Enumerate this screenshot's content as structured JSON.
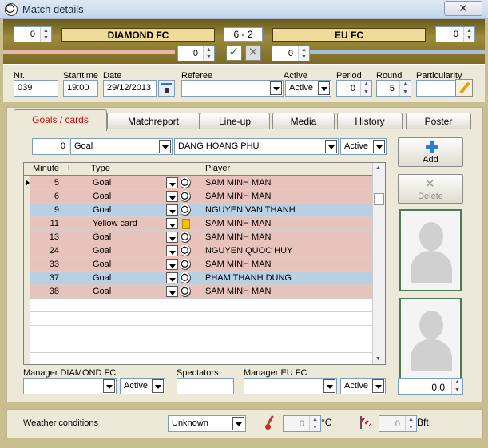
{
  "window": {
    "title": "Match details",
    "close_glyph": "✕"
  },
  "score": {
    "home_team": "DIAMOND FC",
    "away_team": "EU FC",
    "result": "6 - 2",
    "home_left_value": "0",
    "away_right_value": "0",
    "home_mid_value": "0",
    "away_mid_value": "0"
  },
  "info": {
    "nr_label": "Nr.",
    "nr": "039",
    "starttime_label": "Starttime",
    "starttime": "19:00",
    "date_label": "Date",
    "date": "29/12/2013",
    "referee_label": "Referee",
    "referee": "",
    "active_label": "Active",
    "active": "Active",
    "period_label": "Period",
    "period": "0",
    "round_label": "Round",
    "round": "5",
    "particularity_label": "Particularity",
    "particularity": ""
  },
  "tabs": [
    {
      "label": "Goals / cards",
      "active": true
    },
    {
      "label": "Matchreport"
    },
    {
      "label": "Line-up"
    },
    {
      "label": "Media"
    },
    {
      "label": "History"
    },
    {
      "label": "Poster"
    }
  ],
  "filter": {
    "minute": "0",
    "type": "Goal",
    "player": "DANG HOANG PHU",
    "status": "Active"
  },
  "grid": {
    "columns": {
      "minute": "Minute",
      "plus": "+",
      "type": "Type",
      "player": "Player"
    },
    "rows": [
      {
        "minute": "5",
        "type": "Goal",
        "player": "SAM MINH MAN",
        "team": "home",
        "icon": "ball"
      },
      {
        "minute": "6",
        "type": "Goal",
        "player": "SAM MINH MAN",
        "team": "home",
        "icon": "ball"
      },
      {
        "minute": "9",
        "type": "Goal",
        "player": "NGUYEN VAN THANH",
        "team": "away",
        "icon": "ball"
      },
      {
        "minute": "11",
        "type": "Yellow card",
        "player": "SAM MINH MAN",
        "team": "home",
        "icon": "yellow-card"
      },
      {
        "minute": "13",
        "type": "Goal",
        "player": "SAM MINH MAN",
        "team": "home",
        "icon": "ball"
      },
      {
        "minute": "24",
        "type": "Goal",
        "player": "NGUYEN QUOC HUY",
        "team": "home",
        "icon": "ball"
      },
      {
        "minute": "33",
        "type": "Goal",
        "player": "SAM MINH MAN",
        "team": "home",
        "icon": "ball"
      },
      {
        "minute": "37",
        "type": "Goal",
        "player": "PHAM THANH DUNG",
        "team": "away",
        "icon": "ball"
      },
      {
        "minute": "38",
        "type": "Goal",
        "player": "SAM MINH MAN",
        "team": "home",
        "icon": "ball"
      }
    ]
  },
  "actions": {
    "add": "Add",
    "delete": "Delete"
  },
  "bottom": {
    "manager_home_label": "Manager DIAMOND FC",
    "manager_home_status": "Active",
    "spectators_label": "Spectators",
    "spectators": "",
    "manager_away_label": "Manager EU FC",
    "manager_away_status": "Active",
    "rating": "0,0"
  },
  "weather": {
    "label": "Weather conditions",
    "condition": "Unknown",
    "temperature": "0",
    "temperature_unit": "°C",
    "wind": "0",
    "wind_unit": "Bft"
  },
  "colors": {
    "home_row": "#e8c3bc",
    "away_row": "#b8d0e2",
    "active_tab_text": "#c81010"
  }
}
